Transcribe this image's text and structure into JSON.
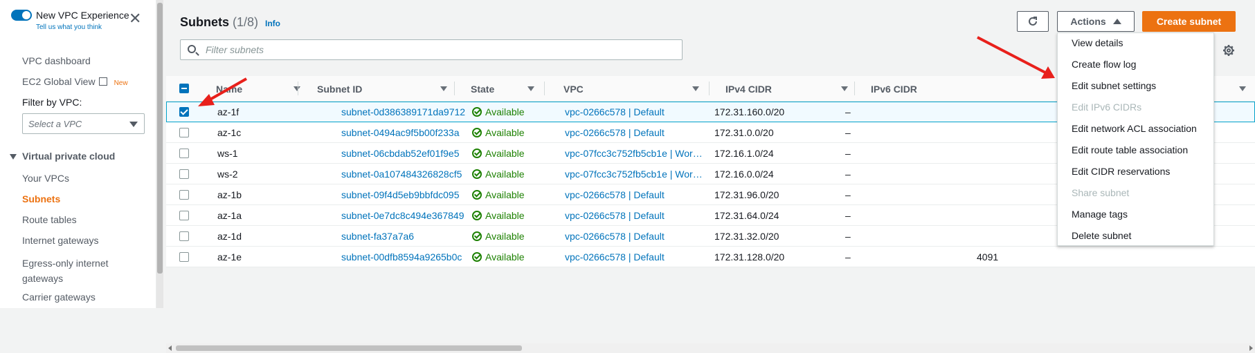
{
  "nav": {
    "experience_label": "New VPC Experience",
    "feedback_link": "Tell us what you think",
    "vpc_dashboard": "VPC dashboard",
    "ec2_global_view": "EC2 Global View",
    "new_badge": "New",
    "filter_by_vpc_label": "Filter by VPC:",
    "select_vpc_placeholder": "Select a VPC",
    "section_title": "Virtual private cloud",
    "items": [
      "Your VPCs",
      "Subnets",
      "Route tables",
      "Internet gateways",
      "Egress-only internet gateways",
      "Carrier gateways"
    ],
    "active_item": "Subnets"
  },
  "header": {
    "title": "Subnets",
    "count": "(1/8)",
    "info": "Info",
    "actions_label": "Actions",
    "create_label": "Create subnet",
    "filter_placeholder": "Filter subnets"
  },
  "table": {
    "columns": [
      "Name",
      "Subnet ID",
      "State",
      "VPC",
      "IPv4 CIDR",
      "IPv6 CIDR"
    ],
    "rows": [
      {
        "name": "az-1f",
        "subnet_id": "subnet-0d386389171da9712",
        "state": "Available",
        "vpc": "vpc-0266c578 | Default",
        "ipv4": "172.31.160.0/20",
        "ipv6": "–",
        "selected": true
      },
      {
        "name": "az-1c",
        "subnet_id": "subnet-0494ac9f5b00f233a",
        "state": "Available",
        "vpc": "vpc-0266c578 | Default",
        "ipv4": "172.31.0.0/20",
        "ipv6": "–",
        "selected": false
      },
      {
        "name": "ws-1",
        "subnet_id": "subnet-06cbdab52ef01f9e5",
        "state": "Available",
        "vpc": "vpc-07fcc3c752fb5cb1e | Wor…",
        "ipv4": "172.16.1.0/24",
        "ipv6": "–",
        "selected": false
      },
      {
        "name": "ws-2",
        "subnet_id": "subnet-0a107484326828cf5",
        "state": "Available",
        "vpc": "vpc-07fcc3c752fb5cb1e | Wor…",
        "ipv4": "172.16.0.0/24",
        "ipv6": "–",
        "selected": false
      },
      {
        "name": "az-1b",
        "subnet_id": "subnet-09f4d5eb9bbfdc095",
        "state": "Available",
        "vpc": "vpc-0266c578 | Default",
        "ipv4": "172.31.96.0/20",
        "ipv6": "–",
        "selected": false
      },
      {
        "name": "az-1a",
        "subnet_id": "subnet-0e7dc8c494e367849",
        "state": "Available",
        "vpc": "vpc-0266c578 | Default",
        "ipv4": "172.31.64.0/24",
        "ipv6": "–",
        "selected": false
      },
      {
        "name": "az-1d",
        "subnet_id": "subnet-fa37a7a6",
        "state": "Available",
        "vpc": "vpc-0266c578 | Default",
        "ipv4": "172.31.32.0/20",
        "ipv6": "–",
        "selected": false
      },
      {
        "name": "az-1e",
        "subnet_id": "subnet-00dfb8594a9265b0c",
        "state": "Available",
        "vpc": "vpc-0266c578 | Default",
        "ipv4": "172.31.128.0/20",
        "ipv6": "–",
        "selected": false,
        "extra": "4091"
      }
    ]
  },
  "actions_menu": {
    "items": [
      {
        "label": "View details",
        "disabled": false
      },
      {
        "label": "Create flow log",
        "disabled": false
      },
      {
        "label": "Edit subnet settings",
        "disabled": false
      },
      {
        "label": "Edit IPv6 CIDRs",
        "disabled": true
      },
      {
        "label": "Edit network ACL association",
        "disabled": false
      },
      {
        "label": "Edit route table association",
        "disabled": false
      },
      {
        "label": "Edit CIDR reservations",
        "disabled": false
      },
      {
        "label": "Share subnet",
        "disabled": true
      },
      {
        "label": "Manage tags",
        "disabled": false
      },
      {
        "label": "Delete subnet",
        "disabled": false
      }
    ]
  },
  "colors": {
    "accent": "#0073bb",
    "primary_button": "#ec7211",
    "available": "#1d8102",
    "annotation_arrow": "#e8201b"
  }
}
